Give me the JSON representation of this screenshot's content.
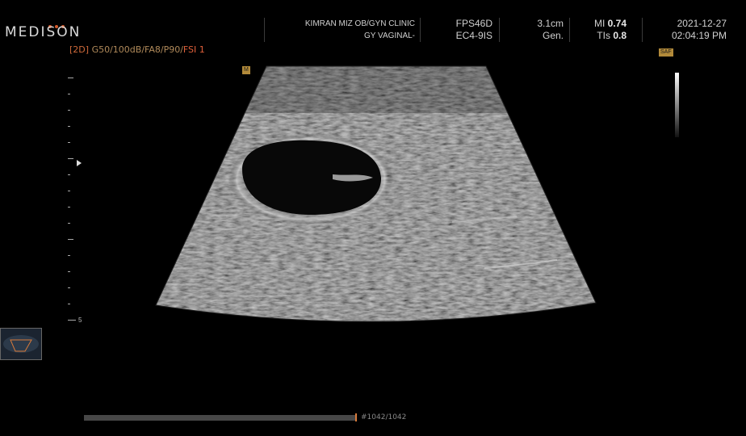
{
  "header": {
    "brand": "MEDISON",
    "clinic_line1": "KIMRAN MIZ OB/GYN CLINIC",
    "clinic_line2": "GY VAGINAL-",
    "frame_rate": "FPS46D",
    "probe": "EC4-9IS",
    "depth": "3.1cm",
    "preset": "Gen.",
    "mi_label": "MI",
    "mi_value": "0.74",
    "tis_label": "TIs",
    "tis_value": "0.8",
    "date": "2021-12-27",
    "time": "02:04:19 PM"
  },
  "imaging_params": {
    "mode": "[2D]",
    "settings": "G50/100dB/FA8/P90/",
    "fsi": "FSI 1"
  },
  "badges": {
    "sector_badge": "M",
    "saf_badge": "SAF"
  },
  "depth_scale": {
    "end_label": "5"
  },
  "cine": {
    "frame_label": "#1042/1042",
    "position_fraction": 1.0
  },
  "colors": {
    "accent_orange": "#e0603a",
    "params_text": "#b08a5a",
    "background": "#000000"
  },
  "icons": {
    "focus_marker": "triangle-right-icon",
    "probe": "probe-orientation-icon"
  }
}
